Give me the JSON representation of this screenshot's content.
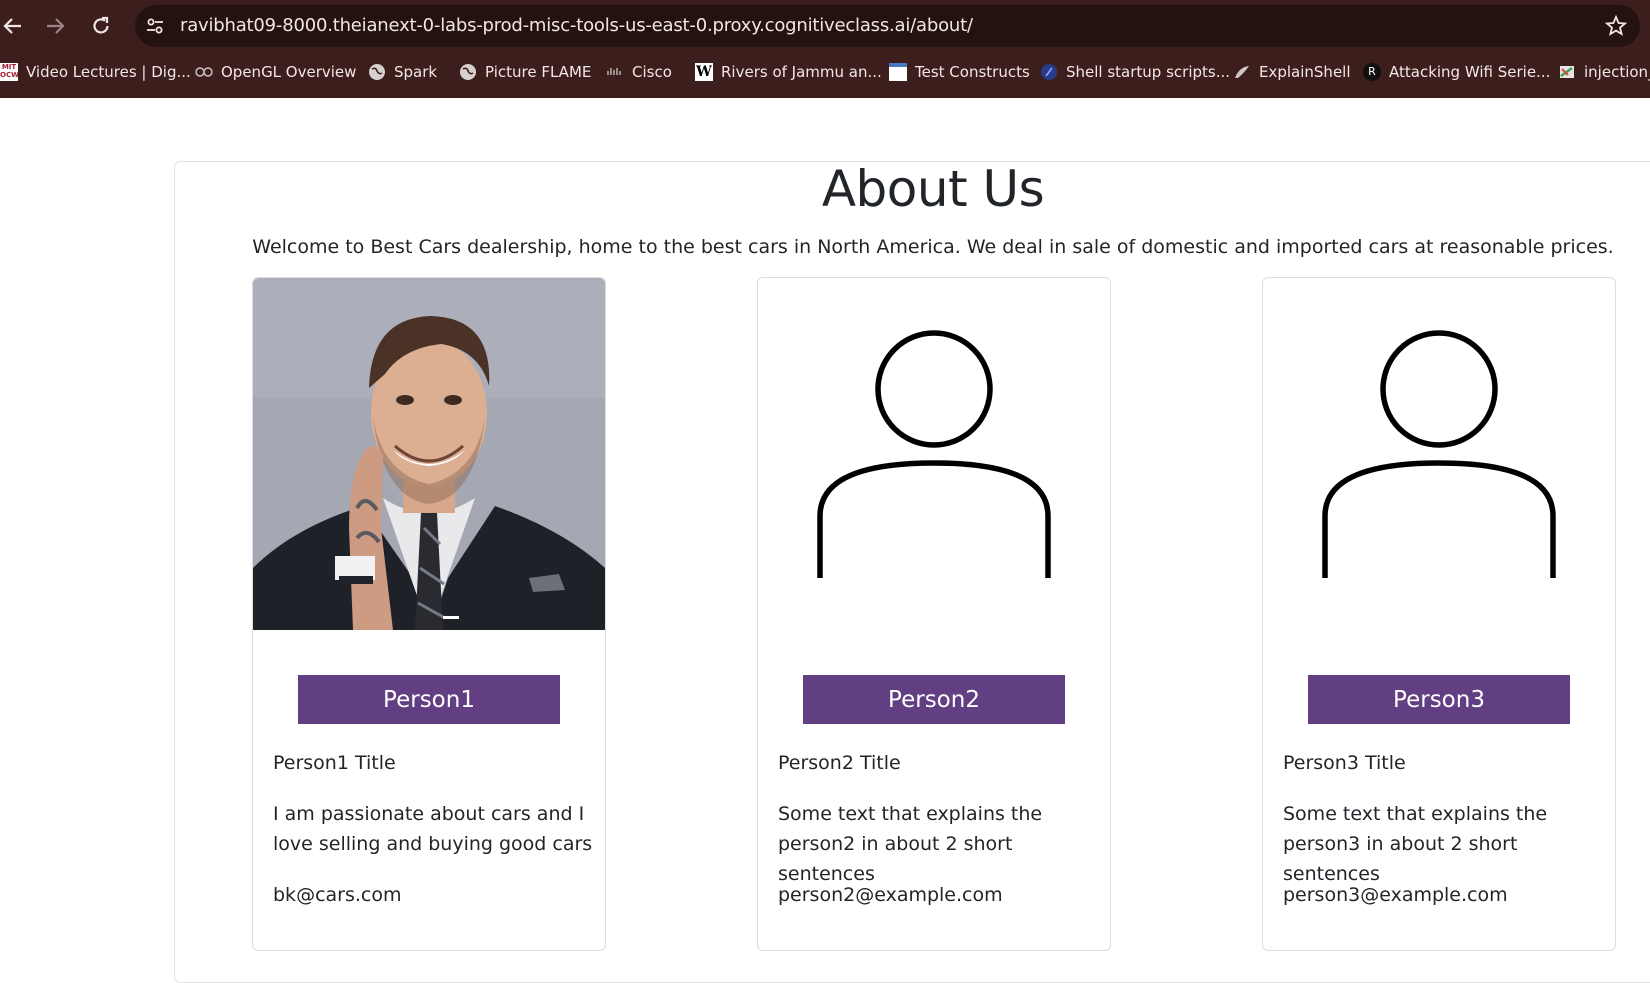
{
  "browser": {
    "url": "ravibhat09-8000.theianext-0-labs-prod-misc-tools-us-east-0.proxy.cognitiveclass.ai/about/",
    "bookmarks": [
      {
        "label": "Video Lectures | Dig...",
        "icon": "mit-ocw-icon"
      },
      {
        "label": "OpenGL Overview",
        "icon": "opengl-icon"
      },
      {
        "label": "Spark",
        "icon": "globe-icon"
      },
      {
        "label": "Picture FLAME",
        "icon": "globe-icon"
      },
      {
        "label": "Cisco",
        "icon": "cisco-icon"
      },
      {
        "label": "Rivers of Jammu an...",
        "icon": "wikipedia-icon"
      },
      {
        "label": "Test Constructs",
        "icon": "page-icon"
      },
      {
        "label": "Shell startup scripts...",
        "icon": "site-icon"
      },
      {
        "label": "ExplainShell",
        "icon": "shell-icon"
      },
      {
        "label": "Attacking Wifi Serie...",
        "icon": "r-icon"
      },
      {
        "label": "injection_",
        "icon": "injection-icon"
      }
    ]
  },
  "page": {
    "title": "About Us",
    "welcome": "Welcome to Best Cars dealership, home to the best cars in North America. We deal in sale of domestic and imported cars at reasonable prices."
  },
  "people": [
    {
      "name": "Person1",
      "title": "Person1 Title",
      "description": "I am passionate about cars and I love selling and buying good cars",
      "email": "bk@cars.com",
      "image": "portrait-photo"
    },
    {
      "name": "Person2",
      "title": "Person2 Title",
      "description": "Some text that explains the person2 in about 2 short sentences",
      "email": "person2@example.com",
      "image": "person-placeholder-icon"
    },
    {
      "name": "Person3",
      "title": "Person3 Title",
      "description": "Some text that explains the person3 in about 2 short sentences",
      "email": "person3@example.com",
      "image": "person-placeholder-icon"
    }
  ],
  "colors": {
    "chrome_bg": "#3c1f1c",
    "button_bg": "#623f82",
    "text": "#212529"
  }
}
